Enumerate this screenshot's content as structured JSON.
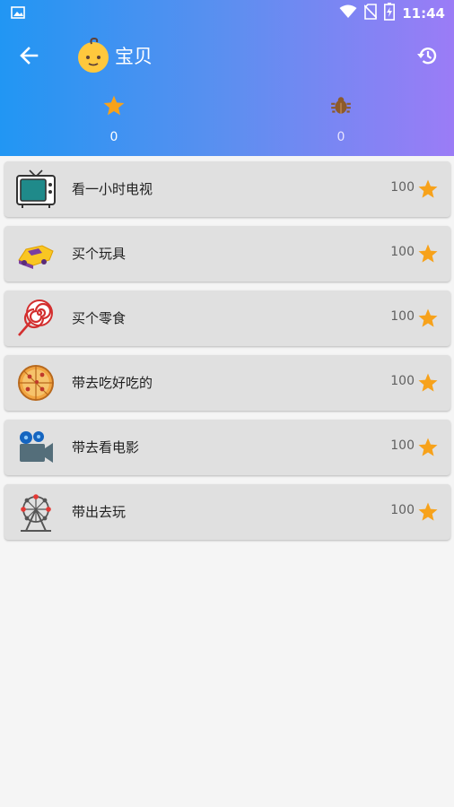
{
  "status_bar": {
    "time": "11:44",
    "icons": [
      "image-icon",
      "wifi-icon",
      "no-sim-icon",
      "battery-charging-icon"
    ]
  },
  "toolbar": {
    "title": "宝贝",
    "back_icon": "arrow-left-icon",
    "avatar_icon": "baby-face-icon",
    "history_icon": "history-icon"
  },
  "stats": {
    "stars": {
      "icon": "star-icon",
      "value": "0"
    },
    "bugs": {
      "icon": "bug-icon",
      "value": "0"
    }
  },
  "rewards": [
    {
      "icon": "tv-icon",
      "label": "看一小时电视",
      "cost": "100"
    },
    {
      "icon": "toy-car-icon",
      "label": "买个玩具",
      "cost": "100"
    },
    {
      "icon": "lollipop-icon",
      "label": "买个零食",
      "cost": "100"
    },
    {
      "icon": "pizza-icon",
      "label": "带去吃好吃的",
      "cost": "100"
    },
    {
      "icon": "movie-camera-icon",
      "label": "带去看电影",
      "cost": "100"
    },
    {
      "icon": "ferris-wheel-icon",
      "label": "带出去玩",
      "cost": "100"
    }
  ],
  "colors": {
    "header_start": "#2196f3",
    "header_end": "#9b7cf6",
    "star": "#f7a21b",
    "card_bg": "#e0e0e0",
    "page_bg": "#f5f5f5"
  }
}
